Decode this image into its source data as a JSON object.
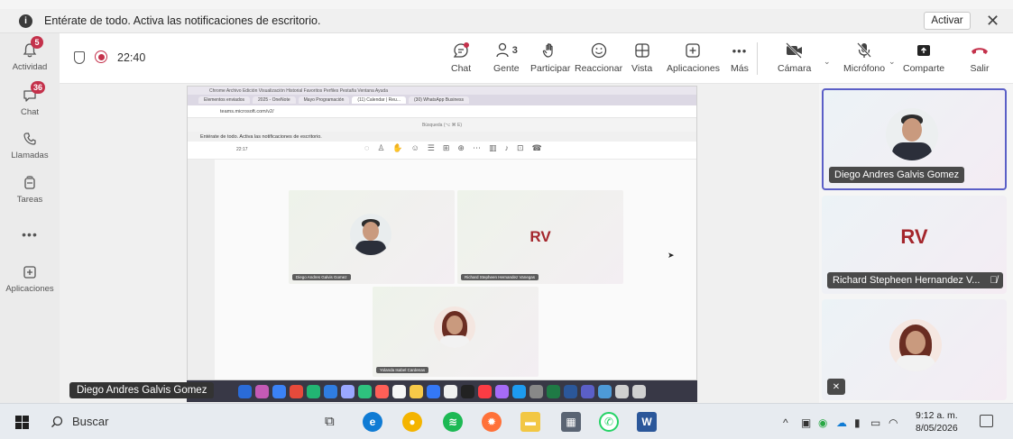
{
  "notification": {
    "message": "Entérate de todo. Activa las notificaciones de escritorio.",
    "activate_label": "Activar",
    "close_glyph": "✕"
  },
  "rail": {
    "items": [
      {
        "label": "Actividad",
        "icon": "bell-icon",
        "badge": "5"
      },
      {
        "label": "Chat",
        "icon": "chat-icon",
        "badge": "36"
      },
      {
        "label": "Llamadas",
        "icon": "phone-icon",
        "badge": ""
      },
      {
        "label": "Tareas",
        "icon": "tasks-icon",
        "badge": ""
      },
      {
        "label": "",
        "icon": "more-icon",
        "badge": ""
      },
      {
        "label": "Aplicaciones",
        "icon": "add-app-icon",
        "badge": ""
      }
    ]
  },
  "meeting": {
    "timer": "22:40",
    "toolbar": {
      "chat": "Chat",
      "people": "Gente",
      "people_count": "3",
      "raise": "Participar",
      "react": "Reaccionar",
      "view": "Vista",
      "apps": "Aplicaciones",
      "more": "Más",
      "camera": "Cámara",
      "mic": "Micrófono",
      "share": "Comparte",
      "leave": "Salir"
    }
  },
  "shared_screen": {
    "mac_menu": "Chrome   Archivo   Edición   Visualización   Historial   Favoritos   Perfiles   Pestaña   Ventana   Ayuda",
    "tabs": [
      "Elementos enviados",
      "2025 - OneNote",
      "Mayo Programación",
      "(11) Calendar | Reu...",
      "(30) WhatsApp Business"
    ],
    "url": "teams.microsoft.com/v2/",
    "search": "Búsqueda (⌥ ⌘ E)",
    "notif": "Entérate de todo. Activa las notificaciones de escritorio.",
    "timer": "22:17",
    "tiles": [
      {
        "name": "Diego Andres Galvis Gomez"
      },
      {
        "name": "Richard Stepheen Hernandez Vanegas",
        "initials": "RV"
      },
      {
        "name": "Yolanda Isabel Cardenas"
      }
    ]
  },
  "presenter_label": "Diego Andres Galvis Gomez",
  "gallery": [
    {
      "name": "Diego Andres Galvis Gomez",
      "speaking": true
    },
    {
      "name": "Richard Stepheen Hernandez V...",
      "initials": "RV",
      "muted": true
    },
    {
      "name": "",
      "muted": true
    }
  ],
  "taskbar": {
    "search": "Buscar",
    "time": "9:12 a. m.",
    "date": "8/05/2026"
  },
  "colors": {
    "accent": "#5b5fc7",
    "badge": "#c4314b",
    "initials": "#a4262c"
  }
}
